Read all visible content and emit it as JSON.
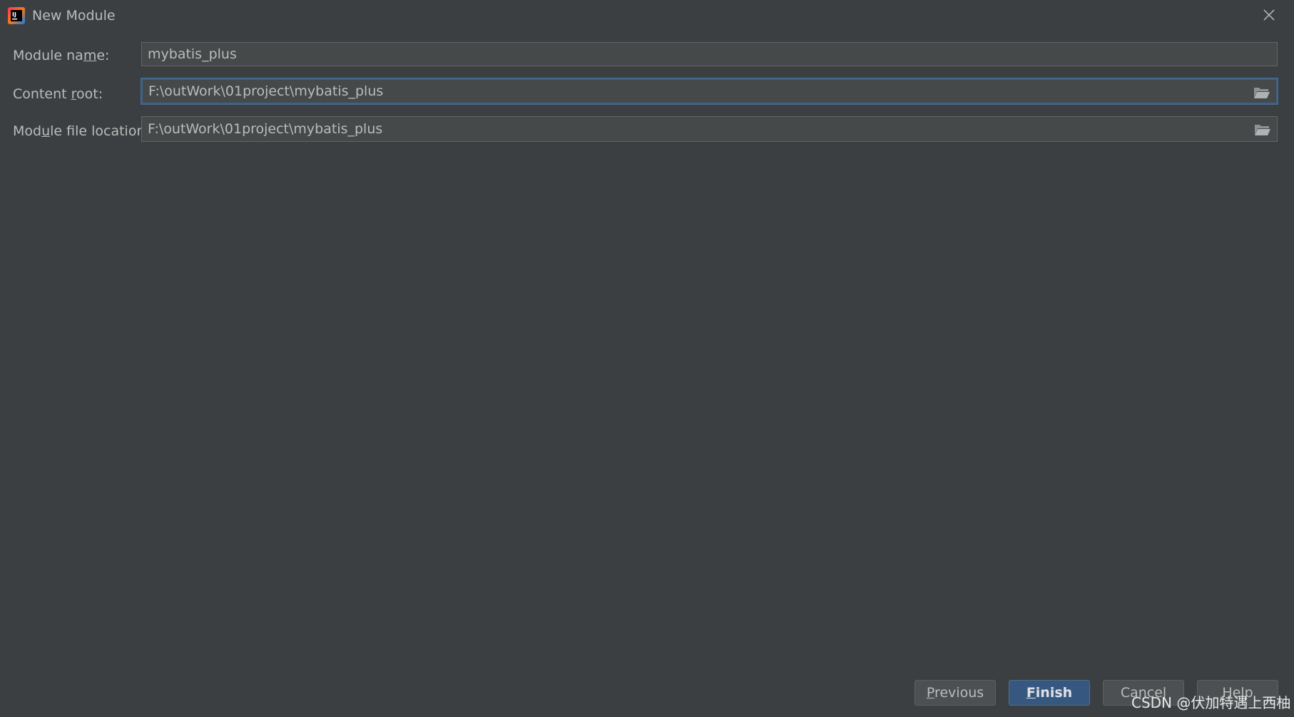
{
  "window": {
    "title": "New Module",
    "app_icon": "intellij-idea-icon",
    "close_icon": "close-icon"
  },
  "form": {
    "module_name": {
      "label_pre": "Module na",
      "label_mnem": "m",
      "label_post": "e:",
      "value": "mybatis_plus"
    },
    "content_root": {
      "label_pre": "Content ",
      "label_mnem": "r",
      "label_post": "oot:",
      "value": "F:\\outWork\\01project\\mybatis_plus",
      "browse_icon": "folder-open-icon"
    },
    "module_file_location": {
      "label_pre": "Mod",
      "label_mnem": "u",
      "label_post": "le file location:",
      "value": "F:\\outWork\\01project\\mybatis_plus",
      "browse_icon": "folder-open-icon"
    }
  },
  "buttons": {
    "previous": {
      "mnem": "P",
      "rest": "revious"
    },
    "finish": {
      "mnem": "F",
      "rest": "inish"
    },
    "cancel": {
      "label": "Cancel"
    },
    "help": {
      "label": "Help"
    }
  },
  "watermark": "CSDN @伏加特遇上西柚",
  "colors": {
    "background": "#3c3f41",
    "field_background": "#45494a",
    "focus_border": "#3d6185",
    "primary_button": "#365880",
    "text": "#bbbbbb"
  }
}
